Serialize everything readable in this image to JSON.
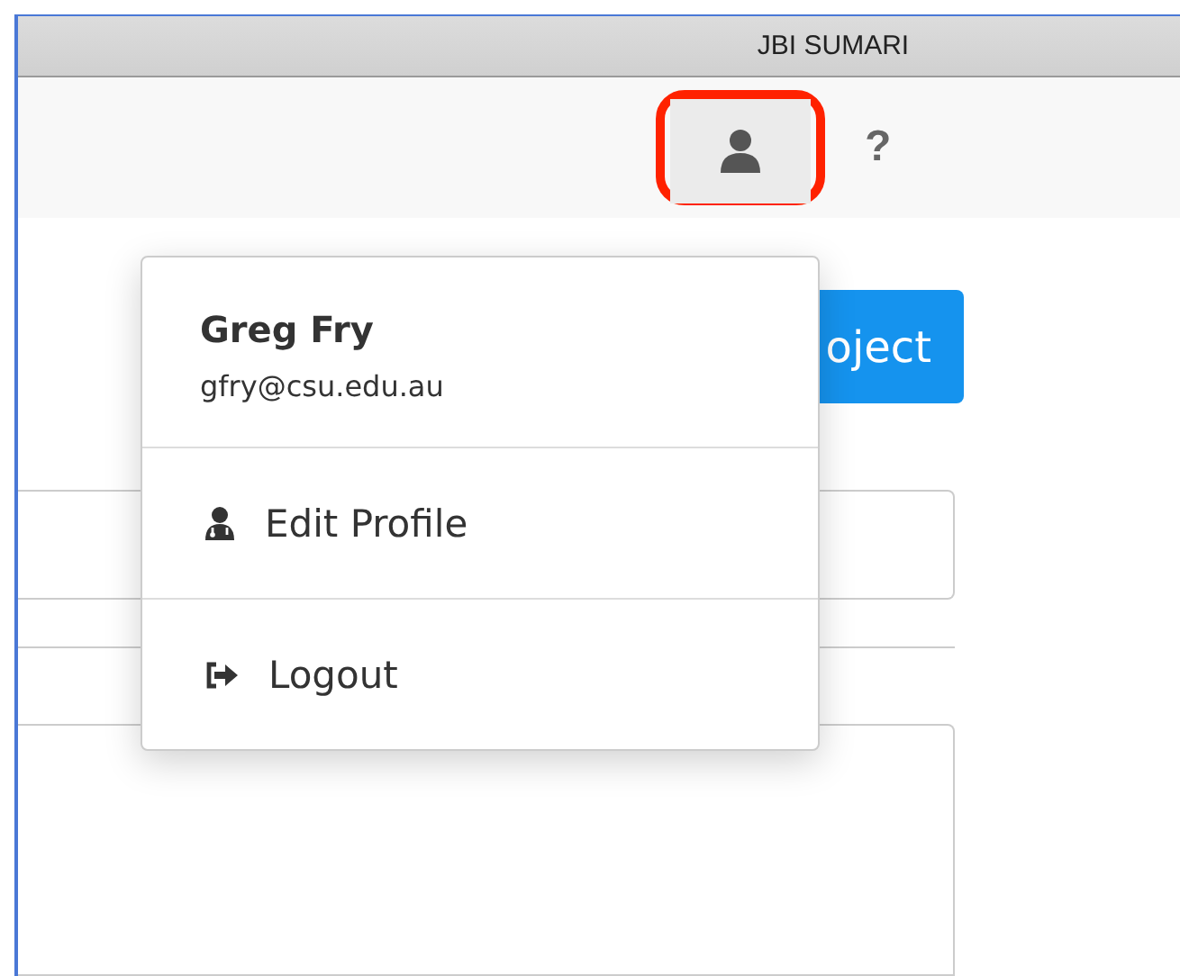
{
  "window": {
    "title": "JBI SUMARI"
  },
  "header": {
    "user_button": {
      "highlighted": true
    },
    "help_label": "?"
  },
  "content": {
    "button_label": "oject"
  },
  "user_menu": {
    "name": "Greg Fry",
    "email": "gfry@csu.edu.au",
    "items": [
      {
        "kind": "profile",
        "label": "Edit Profile"
      },
      {
        "kind": "logout",
        "label": "Logout"
      }
    ]
  }
}
